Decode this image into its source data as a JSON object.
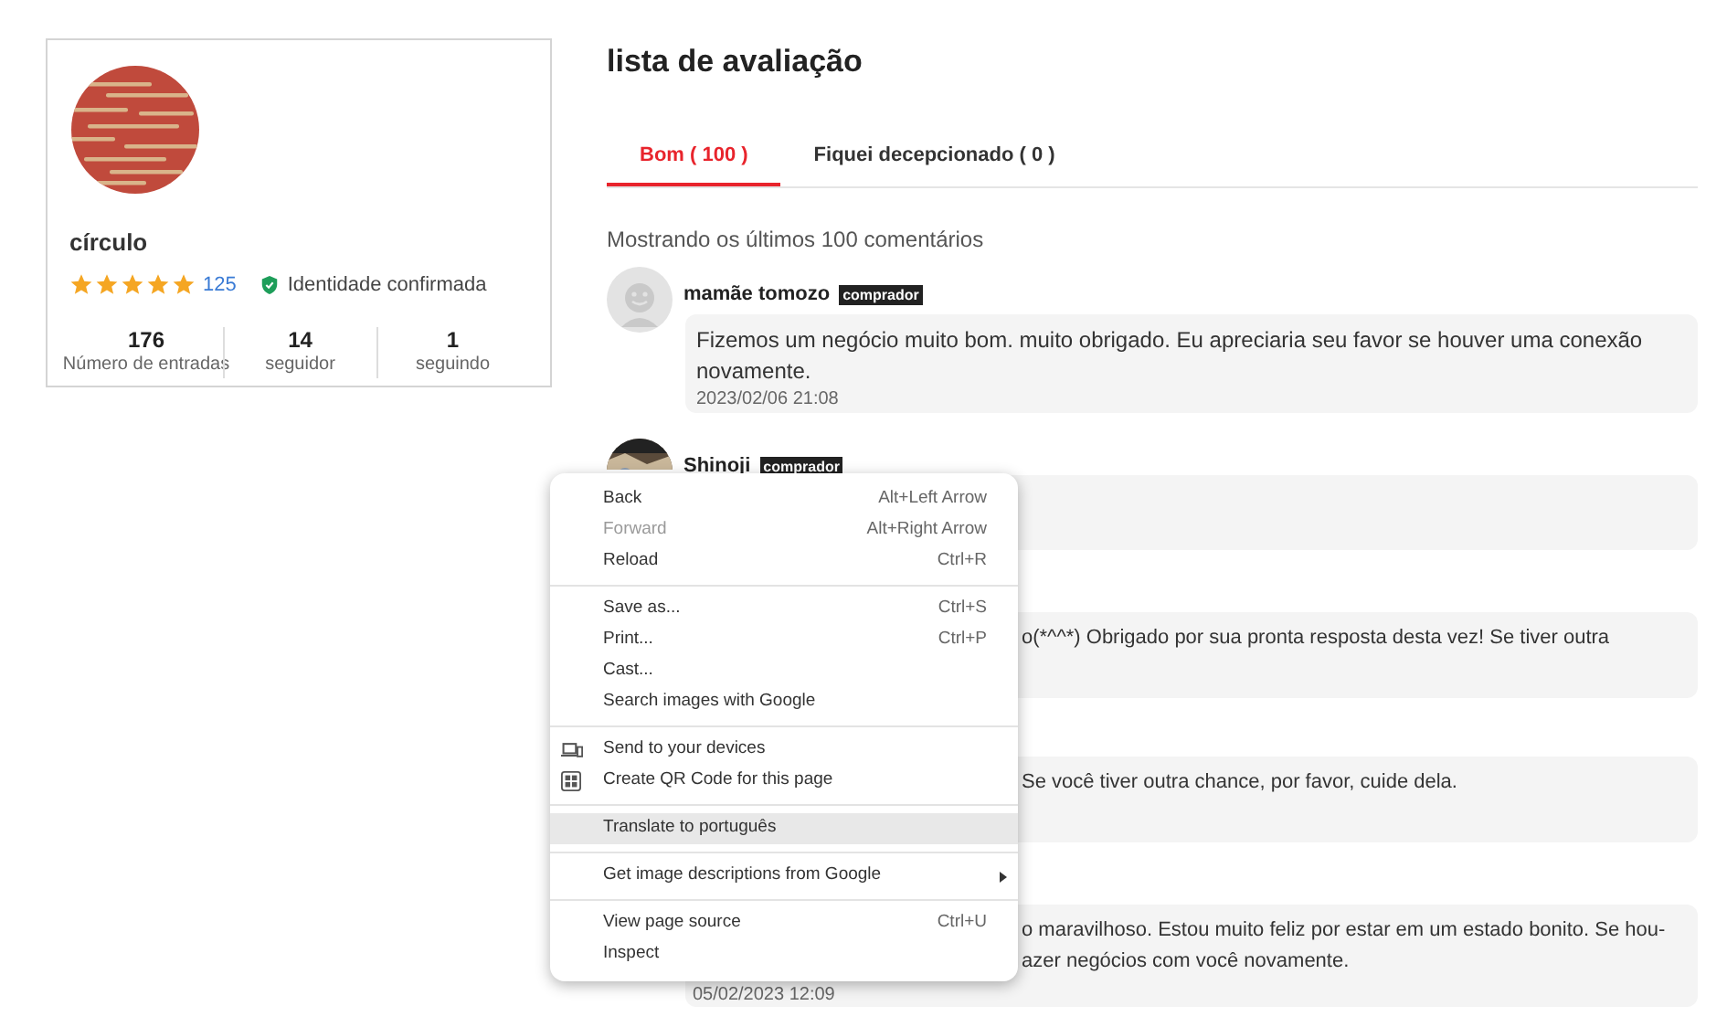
{
  "profile": {
    "name": "círculo",
    "stars": 5,
    "rating_count": "125",
    "verified_label": "Identidade confirmada",
    "stats": [
      {
        "value": "176",
        "label": "Número de entradas"
      },
      {
        "value": "14",
        "label": "seguidor"
      },
      {
        "value": "1",
        "label": "seguindo"
      }
    ]
  },
  "title": "lista de avaliação",
  "tabs": [
    {
      "label": "Bom ( 100 )",
      "selected": true
    },
    {
      "label": "Fiquei decepcionado ( 0 )",
      "selected": false
    }
  ],
  "summary": "Mostrando os últimos 100 comentários",
  "reviews": [
    {
      "kind": "default_avatar",
      "name": "mamãe tomozo",
      "badge": "comprador",
      "lines": [
        "Fizemos um negócio muito bom. muito obrigado. Eu apreciaria seu favor se houver uma conexão novamente."
      ],
      "date": "2023/02/06 21:08"
    },
    {
      "kind": "photo_avatar",
      "name": "Shinoji",
      "badge": "comprador"
    },
    {
      "kind": "covered",
      "lines": [
        "o(*^^*) Obrigado por sua pronta resposta desta vez! Se tiver outra"
      ]
    },
    {
      "kind": "covered",
      "lines": [
        "Se você tiver outra chance, por favor, cuide dela."
      ]
    },
    {
      "kind": "covered",
      "lines": [
        "o maravilhoso. Estou muito feliz por estar em um estado bonito. Se hou-",
        "azer negócios com você novamente."
      ],
      "date": "05/02/2023 12:09"
    }
  ],
  "context_menu": {
    "groups": [
      [
        {
          "kind": "plain",
          "label": "Back",
          "shortcut": "Alt+Left Arrow",
          "disabled": false,
          "selected": false
        },
        {
          "kind": "plain",
          "label": "Forward",
          "shortcut": "Alt+Right Arrow",
          "disabled": true,
          "selected": false
        },
        {
          "kind": "plain",
          "label": "Reload",
          "shortcut": "Ctrl+R",
          "disabled": false,
          "selected": false
        }
      ],
      [
        {
          "kind": "plain",
          "label": "Save as...",
          "shortcut": "Ctrl+S",
          "disabled": false,
          "selected": false
        },
        {
          "kind": "plain",
          "label": "Print...",
          "shortcut": "Ctrl+P",
          "disabled": false,
          "selected": false
        },
        {
          "kind": "plain",
          "label": "Cast...",
          "disabled": false,
          "selected": false
        },
        {
          "kind": "plain",
          "label": "Search images with Google",
          "disabled": false,
          "selected": false
        }
      ],
      [
        {
          "kind": "send",
          "label": "Send to your devices",
          "disabled": false,
          "selected": false
        },
        {
          "kind": "qr",
          "label": "Create QR Code for this page",
          "disabled": false,
          "selected": false
        }
      ],
      [
        {
          "kind": "plain",
          "label": "Translate to português",
          "disabled": false,
          "selected": true
        }
      ],
      [
        {
          "kind": "submenu",
          "label": "Get image descriptions from Google",
          "disabled": false,
          "selected": false
        }
      ],
      [
        {
          "kind": "plain",
          "label": "View page source",
          "shortcut": "Ctrl+U",
          "disabled": false,
          "selected": false
        },
        {
          "kind": "plain",
          "label": "Inspect",
          "disabled": false,
          "selected": false
        }
      ]
    ]
  }
}
